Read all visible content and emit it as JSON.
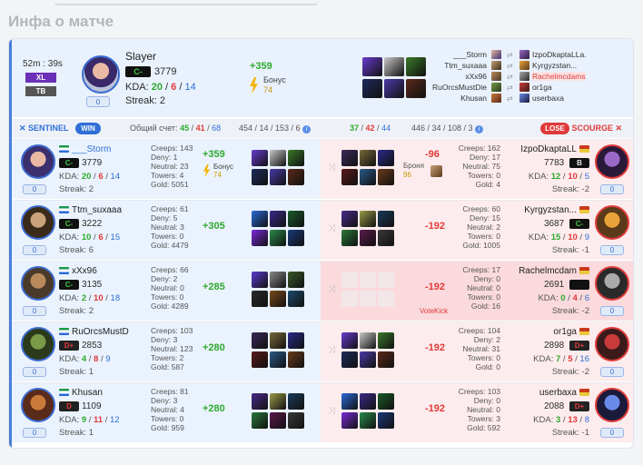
{
  "title": "Инфа о матче",
  "summary": {
    "time": "52m : 39s",
    "badge_xl": "XL",
    "badge_tb": "TB",
    "player": "Slayer",
    "rank": "C-",
    "mmr": "3779",
    "kda_label": "KDA:",
    "kills": "20",
    "deaths": "6",
    "assists": "14",
    "streak": "Streak: 2",
    "level": "0",
    "points": "+359",
    "bonus_label": "Бонус",
    "bonus_value": "74"
  },
  "pairs": [
    {
      "left": "___Storm",
      "right": "IzpoDkaptaLLa.",
      "right_hl": false
    },
    {
      "left": "Ttm_suxaaa",
      "right": "Kyrgyzstan...",
      "right_hl": false
    },
    {
      "left": "xXx96",
      "right": "Rachelmcdams",
      "right_hl": true
    },
    {
      "left": "RuOrcsMustDie",
      "right": "or1ga",
      "right_hl": false
    },
    {
      "left": "Khusan",
      "right": "userbaxa",
      "right_hl": false
    }
  ],
  "bar": {
    "sentinel": "SENTINEL",
    "win": "WIN",
    "total_label": "Общий счет:",
    "s_k": "45",
    "s_d": "41",
    "s_a": "68",
    "s_stats": "454 / 14 / 153 / 6",
    "i_k": "37",
    "i_d": "42",
    "i_a": "44",
    "i_stats": "446 / 34 / 108 / 3",
    "lose": "LOSE",
    "scourge": "SCOURGE"
  },
  "rows": [
    {
      "l": {
        "name": "___Storm",
        "rank": "C-",
        "rtype": "g",
        "mmr": "3779",
        "k": "20",
        "d": "6",
        "a": "14",
        "streak": "Streak: 2",
        "level": "0",
        "creeps": "Creeps: 143",
        "deny": "Deny: 1",
        "neutral": "Neutral: 23",
        "towers": "Towers: 4",
        "gold": "Gold: 5051",
        "pts": "+359",
        "bonus_label": "Бонус",
        "bonus_value": "74"
      },
      "r": {
        "name": "IzpoDkaptaLL",
        "rank": "B",
        "rtype": "b",
        "mmr": "7783",
        "k": "12",
        "d": "10",
        "a": "5",
        "streak": "Streak: -2",
        "level": "0",
        "creeps": "Creeps: 162",
        "deny": "Deny: 17",
        "neutral": "Neutral: 75",
        "towers": "Towers: 0",
        "gold": "Gold: 4",
        "pts": "-96",
        "armor_label": "Броня",
        "armor_value": "96"
      }
    },
    {
      "l": {
        "name": "Ttm_suxaaa",
        "rank": "C-",
        "rtype": "g",
        "mmr": "3222",
        "k": "10",
        "d": "6",
        "a": "15",
        "streak": "Streak: 6",
        "level": "0",
        "creeps": "Creeps: 61",
        "deny": "Deny: 5",
        "neutral": "Neutral: 3",
        "towers": "Towers: 0",
        "gold": "Gold: 4479",
        "pts": "+305"
      },
      "r": {
        "name": "Kyrgyzstan...",
        "rank": "C-",
        "rtype": "g",
        "mmr": "3687",
        "k": "15",
        "d": "10",
        "a": "9",
        "streak": "Streak: -1",
        "level": "0",
        "creeps": "Creeps: 60",
        "deny": "Deny: 15",
        "neutral": "Neutral: 2",
        "towers": "Towers: 0",
        "gold": "Gold: 1005",
        "pts": "-192"
      }
    },
    {
      "l": {
        "name": "xXx96",
        "rank": "C-",
        "rtype": "g",
        "mmr": "3135",
        "k": "2",
        "d": "10",
        "a": "18",
        "streak": "Streak: 2",
        "level": "0",
        "creeps": "Creeps: 66",
        "deny": "Deny: 2",
        "neutral": "Neutral: 0",
        "towers": "Towers: 0",
        "gold": "Gold: 4289",
        "pts": "+285"
      },
      "r": {
        "name": "Rachelmcdam",
        "rank": "",
        "rtype": "b",
        "mmr": "2691",
        "k": "0",
        "d": "4",
        "a": "6",
        "streak": "Streak: -2",
        "level": "0",
        "creeps": "Creeps: 17",
        "deny": "Deny: 0",
        "neutral": "Neutral: 0",
        "towers": "Towers: 0",
        "gold": "Gold: 16",
        "pts": "-192",
        "votekick": "VoteKick"
      }
    },
    {
      "l": {
        "name": "RuOrcsMustD",
        "rank": "D+",
        "rtype": "r",
        "mmr": "2853",
        "k": "4",
        "d": "8",
        "a": "9",
        "streak": "Streak: 1",
        "level": "0",
        "creeps": "Creeps: 103",
        "deny": "Deny: 3",
        "neutral": "Neutral: 123",
        "towers": "Towers: 2",
        "gold": "Gold: 587",
        "pts": "+280"
      },
      "r": {
        "name": "or1ga",
        "rank": "D+",
        "rtype": "r",
        "mmr": "2898",
        "k": "7",
        "d": "5",
        "a": "16",
        "streak": "Streak: -2",
        "level": "0",
        "creeps": "Creeps: 104",
        "deny": "Deny: 2",
        "neutral": "Neutral: 31",
        "towers": "Towers: 0",
        "gold": "Gold: 0",
        "pts": "-192"
      }
    },
    {
      "l": {
        "name": "Khusan",
        "rank": "D",
        "rtype": "r",
        "mmr": "1109",
        "k": "9",
        "d": "11",
        "a": "12",
        "streak": "Streak: 1",
        "level": "0",
        "creeps": "Creeps: 81",
        "deny": "Deny: 3",
        "neutral": "Neutral: 4",
        "towers": "Towers: 0",
        "gold": "Gold: 959",
        "pts": "+280"
      },
      "r": {
        "name": "userbaxa",
        "rank": "D+",
        "rtype": "r",
        "mmr": "2088",
        "k": "3",
        "d": "13",
        "a": "8",
        "streak": "Streak: -1",
        "level": "0",
        "creeps": "Creeps: 103",
        "deny": "Deny: 0",
        "neutral": "Neutral: 0",
        "towers": "Towers: 3",
        "gold": "Gold: 592",
        "pts": "-192"
      }
    }
  ],
  "colors": {
    "sentinel": "#2f6fd6",
    "scourge": "#e03a3a",
    "positive": "#2eaa2e",
    "negative": "#e03a3a",
    "bonus": "#f4b400"
  }
}
